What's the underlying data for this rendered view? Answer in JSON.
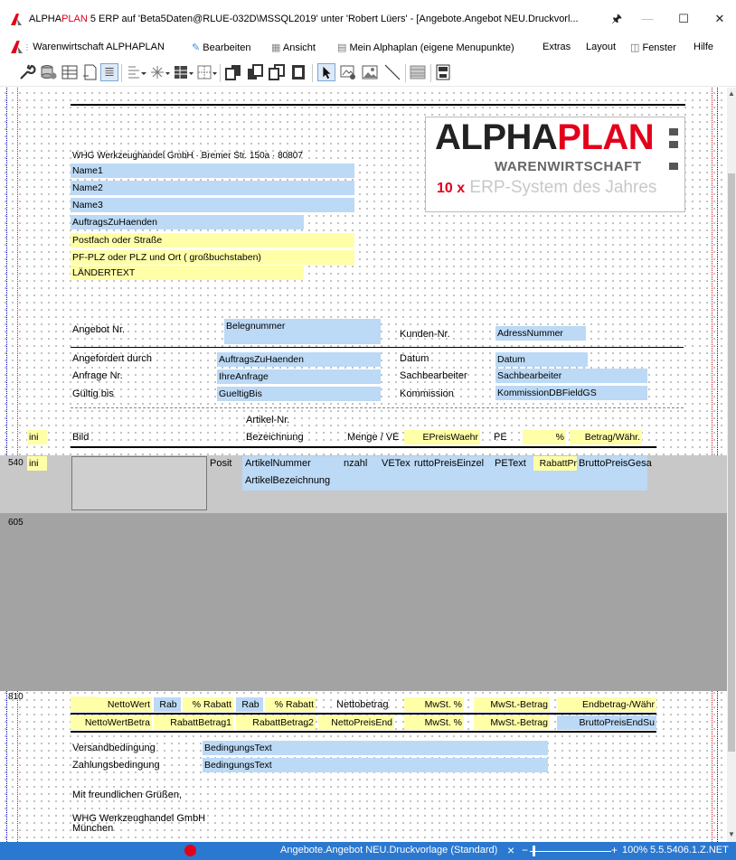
{
  "window": {
    "title_prefix": "ALPHA",
    "title_red": "PLAN",
    "title_rest": " 5 ERP auf 'Beta5Daten@RLUE-032D\\MSSQL2019' unter 'Robert Lüers' - [Angebote.Angebot NEU.Druckvorl...",
    "pin": "🖈",
    "minimize": "—",
    "maximize": "☐",
    "close": "✕"
  },
  "menu": {
    "warenwirtschaft": "Warenwirtschaft ALPHAPLAN",
    "bearbeiten": "Bearbeiten",
    "ansicht": "Ansicht",
    "mein_alphaplan": "Mein Alphaplan (eigene Menupunkte)",
    "extras": "Extras",
    "layout": "Layout",
    "fenster": "Fenster",
    "hilfe": "Hilfe"
  },
  "logo": {
    "alpha": "ALPHA",
    "plan": "PLAN",
    "warenwirtschaft": "WARENWIRTSCHAFT",
    "ten": "10 x",
    "erp": "ERP-System des Jahres"
  },
  "address": {
    "sender": "WHG Werkzeughandel GmbH · Bremer Str. 150a · 80807",
    "name1": "Name1",
    "name2": "Name2",
    "name3": "Name3",
    "zu_haenden": "AuftragsZuHaenden",
    "strasse": "Postfach oder Straße",
    "plz_ort": "PF-PLZ oder PLZ und Ort  ( großbuchstaben)",
    "land": "LÄNDERTEXT"
  },
  "header": {
    "angebot_nr_label": "Angebot Nr.",
    "belegnummer": "Belegnummer",
    "kunden_nr_label": "Kunden-Nr.",
    "adressnummer": "AdressNummer",
    "angefordert_label": "Angefordert durch",
    "angefordert_value": "AuftragsZuHaenden",
    "datum_label": "Datum",
    "datum_value": "Datum",
    "anfrage_label": "Anfrage Nr.",
    "anfrage_value": "IhreAnfrage",
    "sachbearbeiter_label": "Sachbearbeiter",
    "sachbearbeiter_value": "Sachbearbeiter",
    "gueltig_label": "Gültig bis",
    "gueltig_value": "GueltigBis",
    "kommission_label": "Kommission",
    "kommission_value": "KommissionDBFieldGS"
  },
  "columns": {
    "ini": "ini",
    "bild": "Bild",
    "artikel_nr": "Artikel-Nr.",
    "bezeichnung": "Bezeichnung",
    "menge": "Menge / VE",
    "epreis": "EPreisWaehr",
    "pe": "PE",
    "prozent": "%",
    "betrag": "Betrag/Währ."
  },
  "detail": {
    "line_number": "540",
    "ini": "ini",
    "posit": "Posit",
    "artikelnummer": "ArtikelNummer",
    "anzahl": "nzahl",
    "vetext": "VETex",
    "brutto_einzel": "ruttoPreisEinzel",
    "petext": "PEText",
    "rabatt": "RabattPr",
    "brutto_gesamt": "BruttoPreisGesa",
    "artikelbezeichnung": "ArtikelBezeichnung"
  },
  "band605": {
    "line_number": "605"
  },
  "footer": {
    "line_number": "810",
    "row1": [
      "NettoWert",
      "Rab",
      "% Rabatt",
      "Rab",
      "% Rabatt",
      "Nettobetrag",
      "MwSt. %",
      "MwSt.-Betrag",
      "Endbetrag-/Währ"
    ],
    "row2": [
      "NettoWertBetra",
      "RabattBetrag1",
      "RabattBetrag2",
      "NettoPreisEnd",
      "MwSt. %",
      "MwSt.-Betrag",
      "BruttoPreisEndSu"
    ],
    "versand_label": "Versandbedingung",
    "versand_value": "BedingungsText",
    "zahlung_label": "Zahlungsbedingung",
    "zahlung_value": "BedingungsText",
    "gruss": "Mit freundlichen Grüßen,",
    "firma": "WHG Werkzeughandel GmbH",
    "ort": "München"
  },
  "status": {
    "document": "Angebote.Angebot NEU.Druckvorlage (Standard)",
    "zoom": "100%",
    "version": "5.5.5406.1.Z.NET",
    "close": "×",
    "minus": "−",
    "plus": "+"
  },
  "colors": {
    "field_blue": "#bcd9f5",
    "field_yellow": "#ffffa8",
    "brand_red": "#e3001b",
    "status_blue": "#2b78d0"
  }
}
